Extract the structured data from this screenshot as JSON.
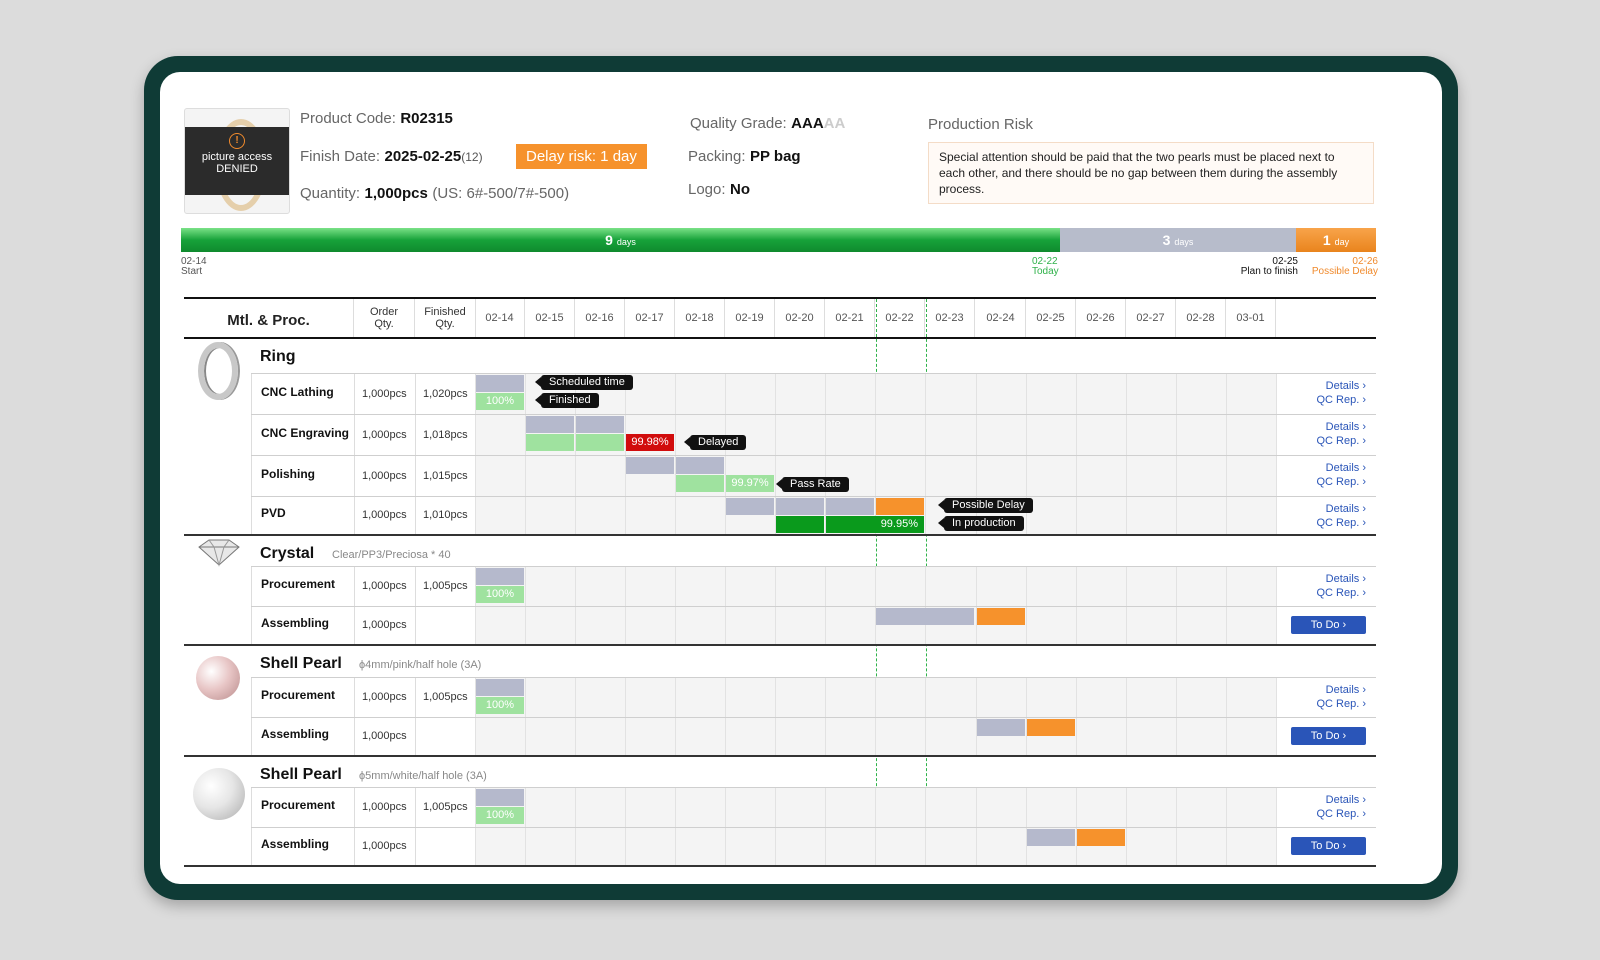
{
  "header": {
    "product_code_label": "Product Code:",
    "product_code": "R02315",
    "finish_date_label": "Finish Date:",
    "finish_date": "2025-02-25",
    "finish_date_sub": "(12)",
    "delay_risk": "Delay risk: 1 day",
    "quantity_label": "Quantity:",
    "quantity": "1,000pcs",
    "quantity_detail": "(US: 6#-500/7#-500)",
    "quality_label": "Quality Grade:",
    "quality_value": "AAA",
    "quality_max": "AA",
    "packing_label": "Packing:",
    "packing_value": "PP bag",
    "logo_label": "Logo:",
    "logo_value": "No",
    "image_denied_line1": "picture access",
    "image_denied_line2": "DENIED"
  },
  "risk": {
    "title": "Production Risk",
    "text": "Special attention should be paid that the two pearls must be placed next to each other, and there should be no gap between them during the assembly process."
  },
  "timeline": {
    "green_days": "9",
    "blue_days": "3",
    "orange_days": "1",
    "unit": "days",
    "unit_single": "day",
    "start_date": "02-14",
    "start_label": "Start",
    "today_date": "02-22",
    "today_label": "Today",
    "plan_date": "02-25",
    "plan_label": "Plan to finish",
    "delay_date": "02-26",
    "delay_label": "Possible Delay"
  },
  "table": {
    "col_material": "Mtl. & Proc.",
    "col_order_1": "Order",
    "col_order_2": "Qty.",
    "col_finished_1": "Finished",
    "col_finished_2": "Qty.",
    "dates": [
      "02-14",
      "02-15",
      "02-16",
      "02-17",
      "02-18",
      "02-19",
      "02-20",
      "02-21",
      "02-22",
      "02-23",
      "02-24",
      "02-25",
      "02-26",
      "02-27",
      "02-28",
      "03-01"
    ]
  },
  "groups": [
    {
      "name": "Ring",
      "spec": "",
      "rows": [
        {
          "name": "CNC Lathing",
          "order": "1,000pcs",
          "finished": "1,020pcs"
        },
        {
          "name": "CNC Engraving",
          "order": "1,000pcs",
          "finished": "1,018pcs"
        },
        {
          "name": "Polishing",
          "order": "1,000pcs",
          "finished": "1,015pcs"
        },
        {
          "name": "PVD",
          "order": "1,000pcs",
          "finished": "1,010pcs"
        }
      ]
    },
    {
      "name": "Crystal",
      "spec": "Clear/PP3/Preciosa * 40",
      "rows": [
        {
          "name": "Procurement",
          "order": "1,000pcs",
          "finished": "1,005pcs"
        },
        {
          "name": "Assembling",
          "order": "1,000pcs",
          "finished": ""
        }
      ]
    },
    {
      "name": "Shell Pearl",
      "spec": "ϕ4mm/pink/half hole (3A)",
      "rows": [
        {
          "name": "Procurement",
          "order": "1,000pcs",
          "finished": "1,005pcs"
        },
        {
          "name": "Assembling",
          "order": "1,000pcs",
          "finished": ""
        }
      ]
    },
    {
      "name": "Shell Pearl",
      "spec": "ϕ5mm/white/half hole (3A)",
      "rows": [
        {
          "name": "Procurement",
          "order": "1,000pcs",
          "finished": "1,005pcs"
        },
        {
          "name": "Assembling",
          "order": "1,000pcs",
          "finished": ""
        }
      ]
    }
  ],
  "bars": {
    "pct_100": "100%",
    "pct_delayed": "99.98%",
    "pct_polish": "99.97%",
    "pct_pvd": "99.95%"
  },
  "tooltips": {
    "scheduled": "Scheduled time",
    "finished": "Finished",
    "delayed": "Delayed",
    "pass_rate": "Pass Rate",
    "possible_delay": "Possible Delay",
    "in_production": "In production"
  },
  "links": {
    "details": "Details ›",
    "qc": "QC Rep. ›",
    "todo": "To Do ›"
  },
  "colors": {
    "scheduled": "#b5b9cc",
    "finished": "#9fe29f",
    "delayed": "#d10c0c",
    "possible_delay": "#f6922c",
    "in_production": "#0a9a1c",
    "accent": "#2a55b8",
    "frame": "#0f3b36"
  }
}
